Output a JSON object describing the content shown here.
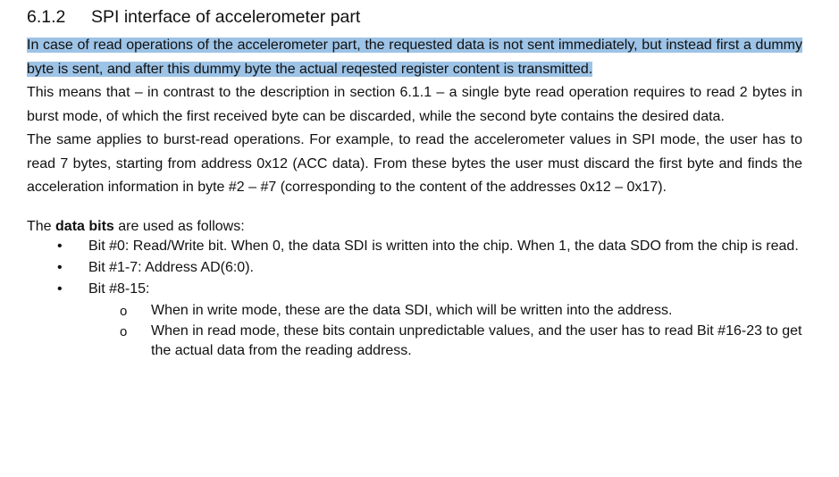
{
  "section": {
    "number": "6.1.2",
    "title": "SPI interface of accelerometer part"
  },
  "paragraphs": {
    "highlighted": "In case of read operations of the accelerometer part, the requested data is not sent immediately, but instead first a dummy byte is sent, and after this dummy byte the actual reqested register content is transmitted.",
    "p1": "This means that – in contrast to the description in section 6.1.1 – a single byte read operation requires to read 2 bytes in burst mode, of which the first received byte can be discarded, while the second byte contains the desired data.",
    "p2": "The same applies to burst-read operations. For example, to read the accelerometer values in SPI mode, the user has to read 7 bytes, starting from address 0x12 (ACC data). From these bytes the user must discard the first byte and finds the acceleration information in byte #2 – #7 (corresponding to the content of the addresses 0x12 – 0x17)."
  },
  "data_bits": {
    "intro_prefix": "The ",
    "intro_bold": "data bits",
    "intro_suffix": " are used as follows:",
    "bullet_marker": "•",
    "sub_marker": "o",
    "items": [
      {
        "text": "Bit #0: Read/Write bit. When 0, the data SDI is written into the chip. When 1, the data SDO from the chip is read."
      },
      {
        "text": "Bit #1-7: Address AD(6:0)."
      },
      {
        "text": "Bit #8-15:"
      }
    ],
    "sub_items": [
      {
        "text": "When in write mode, these are the data SDI, which will be written into the address."
      },
      {
        "text": "When in read mode, these bits contain unpredictable values, and the user has to read Bit #16-23 to get the actual data from the reading address."
      }
    ]
  },
  "colors": {
    "highlight": "#9dc3e6",
    "text": "#111111"
  }
}
